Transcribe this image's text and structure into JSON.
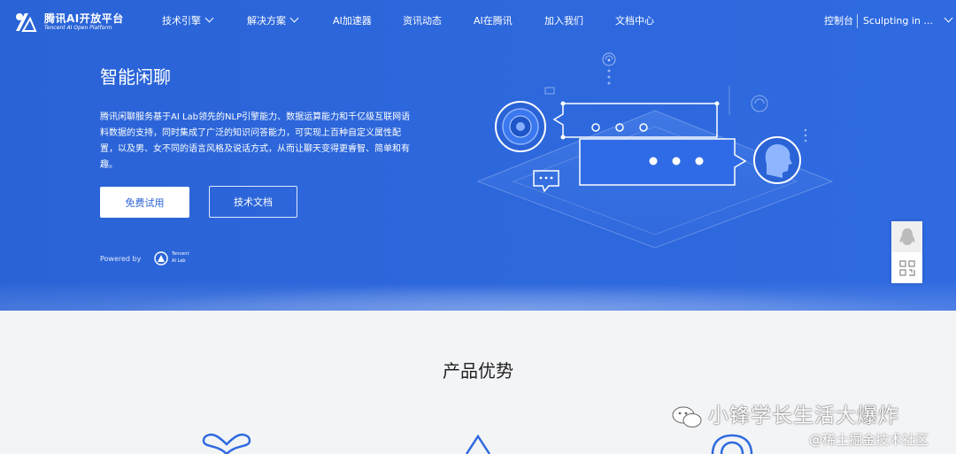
{
  "brand": {
    "title": "腾讯AI开放平台",
    "subtitle": "Tencent AI Open Platform"
  },
  "nav": {
    "items": [
      {
        "label": "技术引擎",
        "dropdown": true
      },
      {
        "label": "解决方案",
        "dropdown": true
      },
      {
        "label": "AI加速器",
        "dropdown": false
      },
      {
        "label": "资讯动态",
        "dropdown": false
      },
      {
        "label": "AI在腾讯",
        "dropdown": false
      },
      {
        "label": "加入我们",
        "dropdown": false
      },
      {
        "label": "文档中心",
        "dropdown": false
      }
    ],
    "console": "控制台",
    "user": "Sculpting in ..."
  },
  "hero": {
    "title": "智能闲聊",
    "description": "腾讯闲聊服务基于AI Lab领先的NLP引擎能力、数据运算能力和千亿级互联网语料数据的支持，同时集成了广泛的知识问答能力，可实现上百种自定义属性配置，以及男、女不同的语言风格及说话方式，从而让聊天变得更睿智、简单和有趣。",
    "primary_button": "免费试用",
    "secondary_button": "技术文档",
    "powered_by": "Powered by",
    "partner_line1": "Tencent",
    "partner_line2": "AI Lab"
  },
  "section": {
    "title": "产品优势"
  },
  "watermark": {
    "line1": "小锋学长生活大爆炸",
    "line2": "@稀土掘金技术社区"
  },
  "colors": {
    "hero_bg": "#2a63d6",
    "page_bg": "#f3f4f6",
    "icon_blue": "#2f6ae0"
  }
}
